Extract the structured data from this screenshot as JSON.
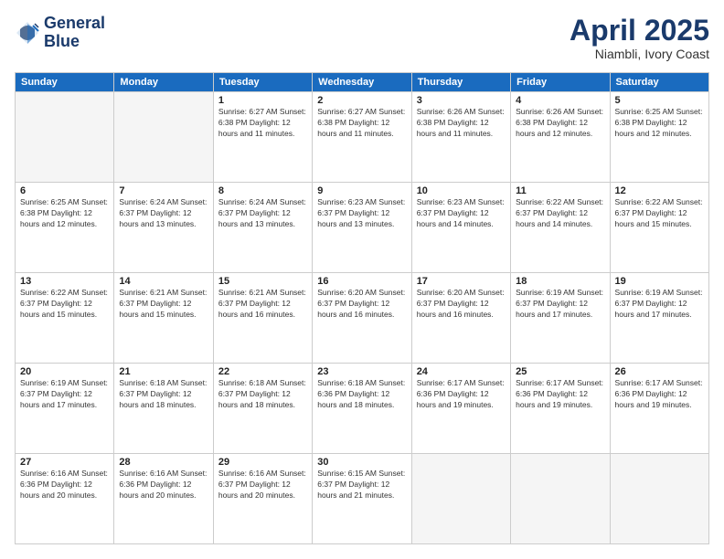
{
  "logo": {
    "line1": "General",
    "line2": "Blue"
  },
  "header": {
    "month": "April 2025",
    "location": "Niambli, Ivory Coast"
  },
  "weekdays": [
    "Sunday",
    "Monday",
    "Tuesday",
    "Wednesday",
    "Thursday",
    "Friday",
    "Saturday"
  ],
  "weeks": [
    [
      {
        "day": "",
        "detail": ""
      },
      {
        "day": "",
        "detail": ""
      },
      {
        "day": "1",
        "detail": "Sunrise: 6:27 AM\nSunset: 6:38 PM\nDaylight: 12 hours\nand 11 minutes."
      },
      {
        "day": "2",
        "detail": "Sunrise: 6:27 AM\nSunset: 6:38 PM\nDaylight: 12 hours\nand 11 minutes."
      },
      {
        "day": "3",
        "detail": "Sunrise: 6:26 AM\nSunset: 6:38 PM\nDaylight: 12 hours\nand 11 minutes."
      },
      {
        "day": "4",
        "detail": "Sunrise: 6:26 AM\nSunset: 6:38 PM\nDaylight: 12 hours\nand 12 minutes."
      },
      {
        "day": "5",
        "detail": "Sunrise: 6:25 AM\nSunset: 6:38 PM\nDaylight: 12 hours\nand 12 minutes."
      }
    ],
    [
      {
        "day": "6",
        "detail": "Sunrise: 6:25 AM\nSunset: 6:38 PM\nDaylight: 12 hours\nand 12 minutes."
      },
      {
        "day": "7",
        "detail": "Sunrise: 6:24 AM\nSunset: 6:37 PM\nDaylight: 12 hours\nand 13 minutes."
      },
      {
        "day": "8",
        "detail": "Sunrise: 6:24 AM\nSunset: 6:37 PM\nDaylight: 12 hours\nand 13 minutes."
      },
      {
        "day": "9",
        "detail": "Sunrise: 6:23 AM\nSunset: 6:37 PM\nDaylight: 12 hours\nand 13 minutes."
      },
      {
        "day": "10",
        "detail": "Sunrise: 6:23 AM\nSunset: 6:37 PM\nDaylight: 12 hours\nand 14 minutes."
      },
      {
        "day": "11",
        "detail": "Sunrise: 6:22 AM\nSunset: 6:37 PM\nDaylight: 12 hours\nand 14 minutes."
      },
      {
        "day": "12",
        "detail": "Sunrise: 6:22 AM\nSunset: 6:37 PM\nDaylight: 12 hours\nand 15 minutes."
      }
    ],
    [
      {
        "day": "13",
        "detail": "Sunrise: 6:22 AM\nSunset: 6:37 PM\nDaylight: 12 hours\nand 15 minutes."
      },
      {
        "day": "14",
        "detail": "Sunrise: 6:21 AM\nSunset: 6:37 PM\nDaylight: 12 hours\nand 15 minutes."
      },
      {
        "day": "15",
        "detail": "Sunrise: 6:21 AM\nSunset: 6:37 PM\nDaylight: 12 hours\nand 16 minutes."
      },
      {
        "day": "16",
        "detail": "Sunrise: 6:20 AM\nSunset: 6:37 PM\nDaylight: 12 hours\nand 16 minutes."
      },
      {
        "day": "17",
        "detail": "Sunrise: 6:20 AM\nSunset: 6:37 PM\nDaylight: 12 hours\nand 16 minutes."
      },
      {
        "day": "18",
        "detail": "Sunrise: 6:19 AM\nSunset: 6:37 PM\nDaylight: 12 hours\nand 17 minutes."
      },
      {
        "day": "19",
        "detail": "Sunrise: 6:19 AM\nSunset: 6:37 PM\nDaylight: 12 hours\nand 17 minutes."
      }
    ],
    [
      {
        "day": "20",
        "detail": "Sunrise: 6:19 AM\nSunset: 6:37 PM\nDaylight: 12 hours\nand 17 minutes."
      },
      {
        "day": "21",
        "detail": "Sunrise: 6:18 AM\nSunset: 6:37 PM\nDaylight: 12 hours\nand 18 minutes."
      },
      {
        "day": "22",
        "detail": "Sunrise: 6:18 AM\nSunset: 6:37 PM\nDaylight: 12 hours\nand 18 minutes."
      },
      {
        "day": "23",
        "detail": "Sunrise: 6:18 AM\nSunset: 6:36 PM\nDaylight: 12 hours\nand 18 minutes."
      },
      {
        "day": "24",
        "detail": "Sunrise: 6:17 AM\nSunset: 6:36 PM\nDaylight: 12 hours\nand 19 minutes."
      },
      {
        "day": "25",
        "detail": "Sunrise: 6:17 AM\nSunset: 6:36 PM\nDaylight: 12 hours\nand 19 minutes."
      },
      {
        "day": "26",
        "detail": "Sunrise: 6:17 AM\nSunset: 6:36 PM\nDaylight: 12 hours\nand 19 minutes."
      }
    ],
    [
      {
        "day": "27",
        "detail": "Sunrise: 6:16 AM\nSunset: 6:36 PM\nDaylight: 12 hours\nand 20 minutes."
      },
      {
        "day": "28",
        "detail": "Sunrise: 6:16 AM\nSunset: 6:36 PM\nDaylight: 12 hours\nand 20 minutes."
      },
      {
        "day": "29",
        "detail": "Sunrise: 6:16 AM\nSunset: 6:37 PM\nDaylight: 12 hours\nand 20 minutes."
      },
      {
        "day": "30",
        "detail": "Sunrise: 6:15 AM\nSunset: 6:37 PM\nDaylight: 12 hours\nand 21 minutes."
      },
      {
        "day": "",
        "detail": ""
      },
      {
        "day": "",
        "detail": ""
      },
      {
        "day": "",
        "detail": ""
      }
    ]
  ]
}
